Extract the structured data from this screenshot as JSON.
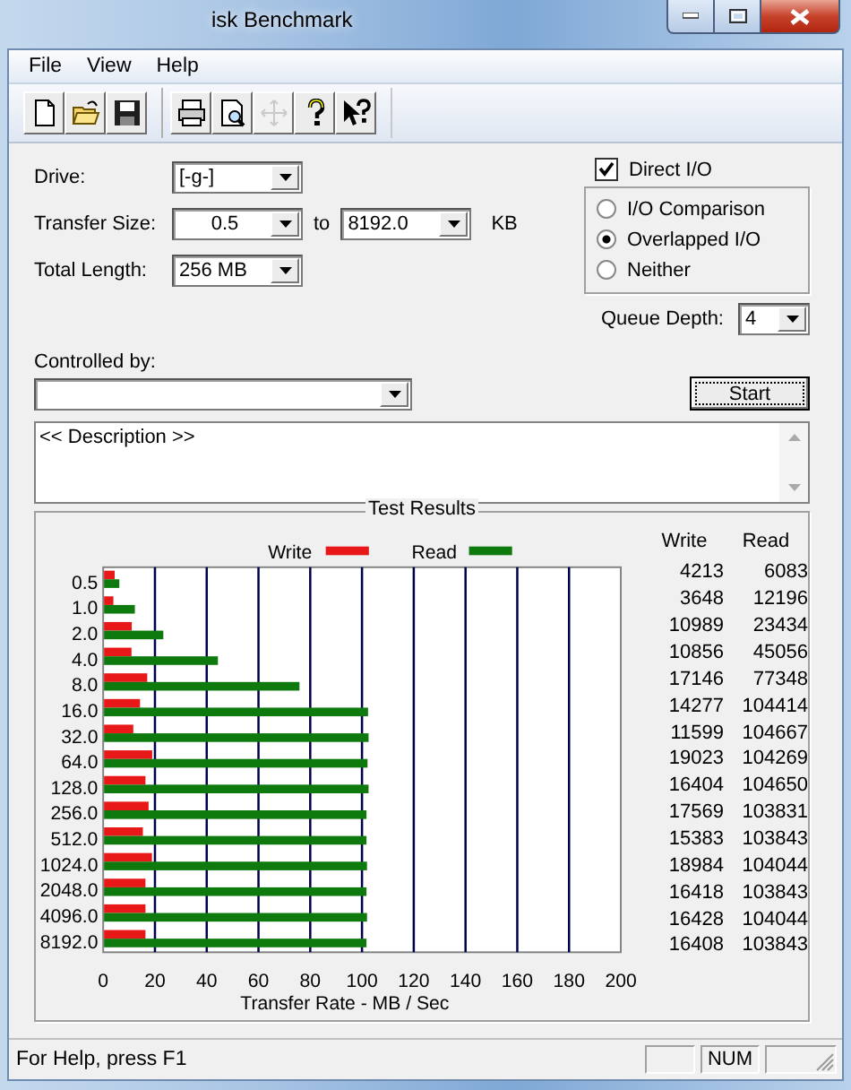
{
  "window": {
    "title": "isk Benchmark"
  },
  "menu": [
    "File",
    "View",
    "Help"
  ],
  "toolbar": [
    {
      "buttons": [
        {
          "kind": "new",
          "disabled": false
        },
        {
          "kind": "open",
          "disabled": false
        },
        {
          "kind": "save",
          "disabled": false
        }
      ]
    },
    {
      "buttons": [
        {
          "kind": "print",
          "disabled": false
        },
        {
          "kind": "preview",
          "disabled": false
        },
        {
          "kind": "move",
          "disabled": true
        },
        {
          "kind": "help",
          "disabled": false
        },
        {
          "kind": "context-help",
          "disabled": false
        }
      ]
    }
  ],
  "settings": {
    "drive": {
      "label": "Drive:",
      "value": "[-g-]"
    },
    "transfer_size": {
      "label": "Transfer Size:",
      "from": "0.5",
      "to_label": "to",
      "to": "8192.0",
      "unit": "KB"
    },
    "total_length": {
      "label": "Total Length:",
      "value": "256 MB"
    },
    "direct_io": {
      "label": "Direct I/O",
      "checked": true
    },
    "io_modes": [
      {
        "label": "I/O Comparison",
        "selected": false
      },
      {
        "label": "Overlapped I/O",
        "selected": true
      },
      {
        "label": "Neither",
        "selected": false
      }
    ],
    "queue_depth": {
      "label": "Queue Depth:",
      "value": "4"
    },
    "controlled_by": {
      "label": "Controlled by:"
    },
    "start_button": "Start",
    "description": "<< Description >>"
  },
  "results": {
    "title": "Test Results",
    "chart_data": {
      "type": "bar",
      "orientation": "horizontal",
      "xlabel": "Transfer Rate - MB / Sec",
      "categories": [
        "0.5",
        "1.0",
        "2.0",
        "4.0",
        "8.0",
        "16.0",
        "32.0",
        "64.0",
        "128.0",
        "256.0",
        "512.0",
        "1024.0",
        "2048.0",
        "4096.0",
        "8192.0"
      ],
      "series": [
        {
          "name": "Write",
          "color": "#e81818",
          "values": [
            4.1,
            3.6,
            10.7,
            10.6,
            16.7,
            13.9,
            11.3,
            18.6,
            16.0,
            17.2,
            15.0,
            18.5,
            16.0,
            16.0,
            16.0
          ]
        },
        {
          "name": "Read",
          "color": "#0e7a0e",
          "values": [
            5.9,
            11.9,
            22.9,
            44.0,
            75.5,
            102.0,
            102.2,
            101.8,
            102.2,
            101.4,
            101.4,
            101.6,
            101.4,
            101.6,
            101.4
          ]
        }
      ],
      "grid": true,
      "legend": true,
      "xlim": [
        0,
        200
      ],
      "xticks": [
        0,
        20,
        40,
        60,
        80,
        100,
        120,
        140,
        160,
        180,
        200
      ]
    },
    "table": {
      "columns": [
        "Write",
        "Read"
      ],
      "rows": [
        [
          "4213",
          "6083"
        ],
        [
          "3648",
          "12196"
        ],
        [
          "10989",
          "23434"
        ],
        [
          "10856",
          "45056"
        ],
        [
          "17146",
          "77348"
        ],
        [
          "14277",
          "104414"
        ],
        [
          "11599",
          "104667"
        ],
        [
          "19023",
          "104269"
        ],
        [
          "16404",
          "104650"
        ],
        [
          "17569",
          "103831"
        ],
        [
          "15383",
          "103843"
        ],
        [
          "18984",
          "104044"
        ],
        [
          "16418",
          "103843"
        ],
        [
          "16428",
          "104044"
        ],
        [
          "16408",
          "103843"
        ]
      ]
    }
  },
  "status_bar": {
    "text": "For Help, press F1",
    "num_indicator": "NUM"
  }
}
